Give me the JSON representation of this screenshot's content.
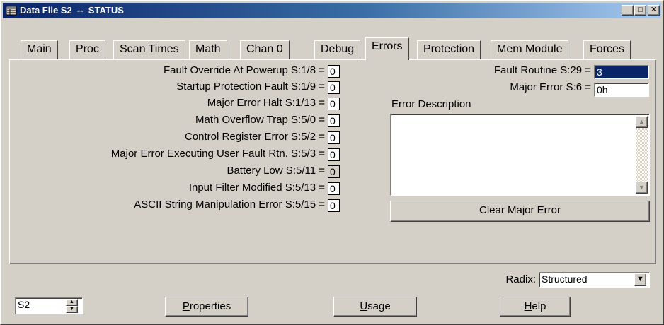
{
  "window": {
    "title": "Data File S2  --  STATUS",
    "min": "_",
    "max": "□",
    "close": "✕"
  },
  "tabs": [
    "Main",
    "Proc",
    "Scan Times",
    "Math",
    "Chan 0",
    "Debug",
    "Errors",
    "Protection",
    "Mem Module",
    "Forces"
  ],
  "active_tab": "Errors",
  "rows": [
    {
      "label": "Fault Override At Powerup S:1/8 =",
      "value": "0"
    },
    {
      "label": "Startup Protection Fault S:1/9 =",
      "value": "0"
    },
    {
      "label": "Major Error Halt S:1/13 =",
      "value": "0"
    },
    {
      "label": "Math Overflow Trap S:5/0 =",
      "value": "0"
    },
    {
      "label": "Control Register Error S:5/2 =",
      "value": "0"
    },
    {
      "label": "Major Error Executing User Fault Rtn. S:5/3 =",
      "value": "0"
    },
    {
      "label": "Battery Low S:5/11 =",
      "value": "0"
    },
    {
      "label": "Input Filter Modified S:5/13 =",
      "value": "0"
    },
    {
      "label": "ASCII String Manipulation Error S:5/15 =",
      "value": "0"
    }
  ],
  "fault_routine": {
    "label": "Fault Routine S:29 =",
    "value": "3"
  },
  "major_error": {
    "label": "Major Error S:6 =",
    "value": "0h"
  },
  "error_description": {
    "label": "Error Description",
    "value": ""
  },
  "clear_button": "Clear Major Error",
  "radix": {
    "label": "Radix:",
    "value": "Structured"
  },
  "file_field": {
    "value": "S2"
  },
  "buttons": {
    "properties_underline": "P",
    "properties_rest": "roperties",
    "usage_underline": "U",
    "usage_rest": "sage",
    "help_underline": "H",
    "help_rest": "elp"
  },
  "colors": {
    "titlebar_start": "#0a246a",
    "titlebar_end": "#a6caf0",
    "face": "#d4d0c8",
    "selection": "#0a246a"
  }
}
